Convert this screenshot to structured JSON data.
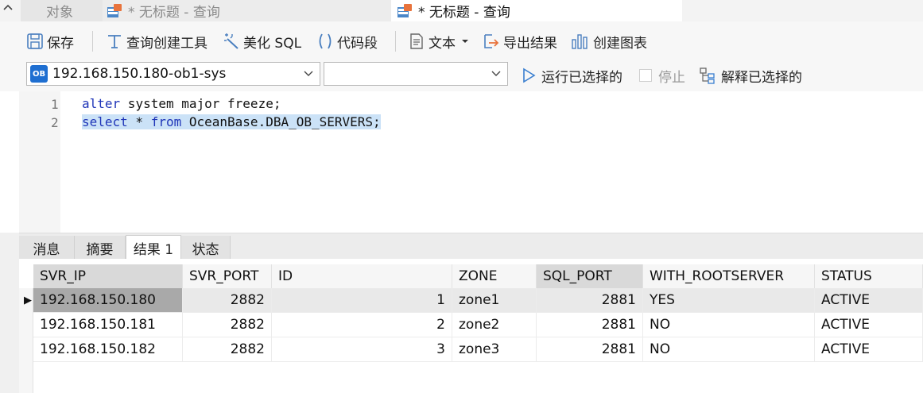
{
  "tabs": {
    "objects": "对象",
    "query1": "* 无标题 - 查询",
    "query2": "* 无标题 - 查询"
  },
  "toolbar": {
    "save": "保存",
    "query_builder": "查询创建工具",
    "beautify_sql": "美化 SQL",
    "code_snippet": "代码段",
    "text": "文本",
    "export_result": "导出结果",
    "create_chart": "创建图表"
  },
  "connection": {
    "badge": "OB",
    "name": "192.168.150.180-ob1-sys",
    "database": "",
    "run_selected": "运行已选择的",
    "stop": "停止",
    "explain_selected": "解释已选择的"
  },
  "editor": {
    "line_numbers": [
      "1",
      "2"
    ],
    "line1_kw": "alter",
    "line1_rest": " system major freeze;",
    "line2_kw1": "select",
    "line2_mid": " * ",
    "line2_kw2": "from",
    "line2_rest": " OceanBase.DBA_OB_SERVERS;"
  },
  "result_tabs": [
    "消息",
    "摘要",
    "结果 1",
    "状态"
  ],
  "grid": {
    "columns": [
      "SVR_IP",
      "SVR_PORT",
      "ID",
      "ZONE",
      "SQL_PORT",
      "WITH_ROOTSERVER",
      "STATUS"
    ],
    "rows": [
      [
        "192.168.150.180",
        "2882",
        "1",
        "zone1",
        "2881",
        "YES",
        "ACTIVE"
      ],
      [
        "192.168.150.181",
        "2882",
        "2",
        "zone2",
        "2881",
        "NO",
        "ACTIVE"
      ],
      [
        "192.168.150.182",
        "2882",
        "3",
        "zone3",
        "2881",
        "NO",
        "ACTIVE"
      ]
    ],
    "current_row_marker": "▶"
  },
  "colors": {
    "keyword": "#1f35b8",
    "selection": "#cbe2f7",
    "ob_badge": "#1f6fd1"
  }
}
